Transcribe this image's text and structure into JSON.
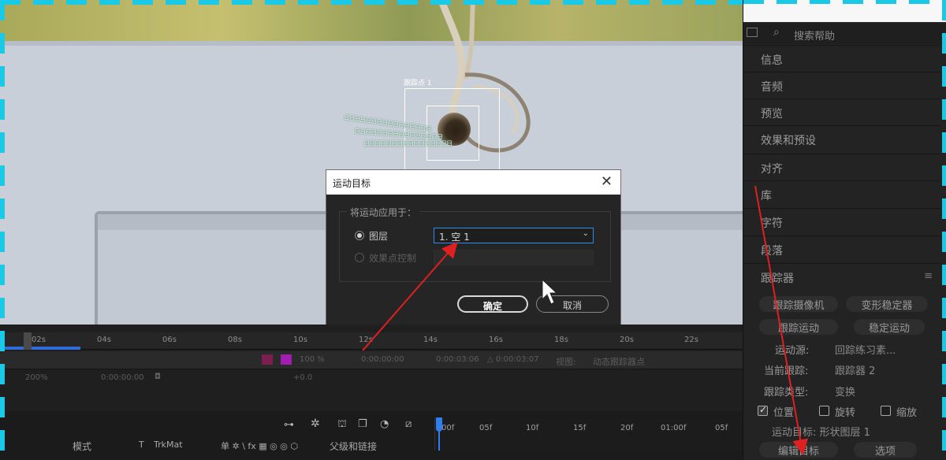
{
  "viewer": {
    "tracker_label": "跟踪点 1",
    "trail_text": "日日日日日日日日日日日日日日日日"
  },
  "dialog": {
    "title": "运动目标",
    "close": "✕",
    "group_label": "将运动应用于：",
    "option_layer": "图层",
    "option_effect": "效果点控制",
    "layer_value": "1. 空 1",
    "ok": "确定",
    "cancel": "取消"
  },
  "right_panel": {
    "search_placeholder": "搜索帮助",
    "items": [
      "信息",
      "音频",
      "预览",
      "效果和预设",
      "对齐",
      "库",
      "字符",
      "段落"
    ],
    "tracker": {
      "title": "跟踪器",
      "btn_track_camera": "跟踪摄像机",
      "btn_warp_stabilizer": "变形稳定器",
      "btn_track_motion": "跟踪运动",
      "btn_stabilize_motion": "稳定运动",
      "motion_source_label": "运动源:",
      "motion_source_value": "回踪练习素...",
      "current_track_label": "当前跟踪:",
      "current_track_value": "跟踪器 2",
      "track_type_label": "跟踪类型:",
      "track_type_value": "变换",
      "chk_position": "位置",
      "chk_rotation": "旋转",
      "chk_scale": "缩放",
      "motion_target": "运动目标: 形状图层 1",
      "btn_edit_target": "编辑目标",
      "btn_options": "选项"
    }
  },
  "timeline": {
    "ruler_ticks": [
      "02s",
      "04s",
      "06s",
      "08s",
      "10s",
      "12s",
      "14s",
      "16s",
      "18s",
      "20s",
      "22s"
    ],
    "strip_values": {
      "percent": "100 %",
      "start": "0:00:00:00",
      "end": "0:00:03:06",
      "duration": "△ 0:00:03:07",
      "view_label": "视图:",
      "view_value": "动态跟踪器点",
      "zoom": "200%",
      "timecode": "0:00:00:00",
      "exposure": "+0.0"
    },
    "columns": {
      "mode": "模式",
      "t": "T",
      "trkmat": "TrkMat",
      "switches": "单 ✲ \\ fx ▦ ◎ ◎ ⬡",
      "parent": "父级和链接"
    },
    "frame_ticks": [
      "00f",
      "05f",
      "10f",
      "15f",
      "20f",
      "01:00f",
      "05f"
    ]
  },
  "colors": {
    "dashed_frame": "#19c9e6",
    "annotation_arrow": "#e02020",
    "select_border": "#2d8ceb"
  }
}
